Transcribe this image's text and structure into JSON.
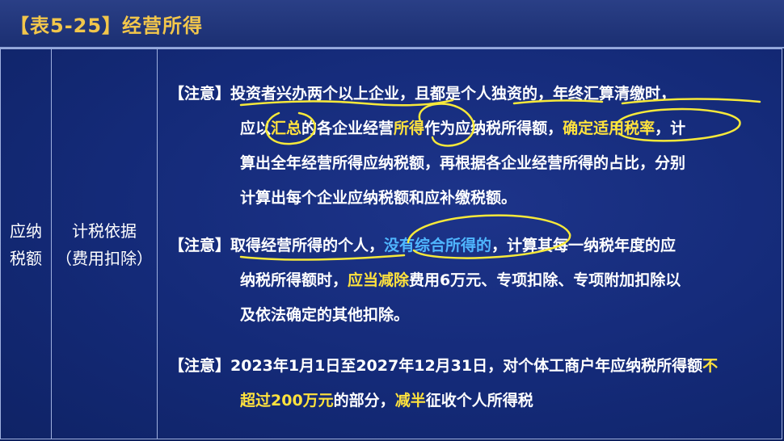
{
  "header": {
    "title": "【表5-25】经营所得"
  },
  "row": {
    "col1_line1": "应纳",
    "col1_line2": "税额",
    "col2_line1": "计税依据",
    "col2_line2": "（费用扣除）"
  },
  "notes": [
    {
      "tag": "【注意】",
      "l1": "投资者兴办两个以上企业，且都是个人独资的，年终汇算清缴时，",
      "l2a": "应以",
      "l2b": "汇总",
      "l2c": "的各企业经营",
      "l2d": "所得",
      "l2e": "作为应纳税所得额，",
      "l2f": "确定适用税率",
      "l2g": "，计",
      "l3": "算出全年经营所得应纳税额，再根据各企业经营所得的占比，分别",
      "l4": "计算出每个企业应纳税额和应补缴税额。"
    },
    {
      "tag": "【注意】",
      "l1a": "取得经营所得的个人，",
      "l1b": "没有综合所得的",
      "l1c": "，计算其每一纳税年度的应",
      "l2a": "纳税所得额时，",
      "l2b": "应当减除",
      "l2c": "费用6万元、专项扣除、专项附加扣除以",
      "l3": "及依法确定的其他扣除。"
    },
    {
      "tag": "【注意】",
      "l1a": "2023年1月1日至2027年12月31日，对个体工商户年应纳税所得额",
      "l1b": "不",
      "l2a": "超过200万元",
      "l2b": "的部分，",
      "l2c": "减半",
      "l2d": "征收个人所得税"
    }
  ],
  "colors": {
    "background": "#142a78",
    "title": "#f2c64b",
    "highlight": "#ffe23d",
    "blue_text": "#4fb6ff"
  }
}
